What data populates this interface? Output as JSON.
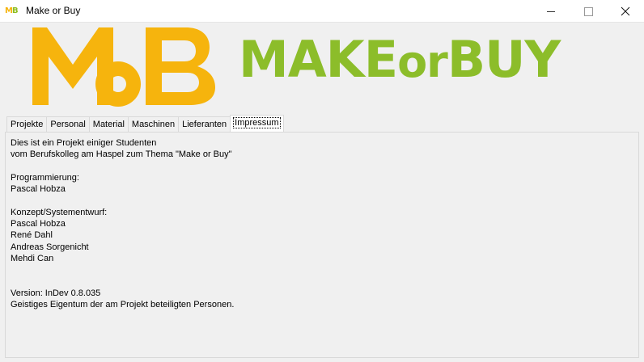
{
  "window": {
    "title": "Make or Buy",
    "icon": "mob-app-icon",
    "controls": [
      "minimize",
      "maximize",
      "close"
    ]
  },
  "header": {
    "logo_mark": "MoB",
    "brand_part1": "MAKE",
    "brand_part2": "or",
    "brand_part3": "BUY",
    "colors": {
      "logo_orange": "#F6B40D",
      "brand_green": "#8CBD2A"
    }
  },
  "tabs": [
    {
      "label": "Projekte"
    },
    {
      "label": "Personal"
    },
    {
      "label": "Material"
    },
    {
      "label": "Maschinen"
    },
    {
      "label": "Lieferanten"
    },
    {
      "label": "Impressum",
      "active": true
    }
  ],
  "impressum": {
    "intro_line1": "Dies ist ein Projekt einiger Studenten",
    "intro_line2": "vom Berufskolleg am Haspel zum Thema \"Make or Buy\"",
    "programming_heading": "Programmierung:",
    "programmers": [
      "Pascal Hobza"
    ],
    "concept_heading": "Konzept/Systementwurf:",
    "concept_people": [
      "Pascal Hobza",
      "René Dahl",
      "Andreas Sorgenicht",
      "Mehdi Can"
    ],
    "version": "Version: InDev 0.8.035",
    "rights": "Geistiges Eigentum der am Projekt beteiligten Personen."
  }
}
